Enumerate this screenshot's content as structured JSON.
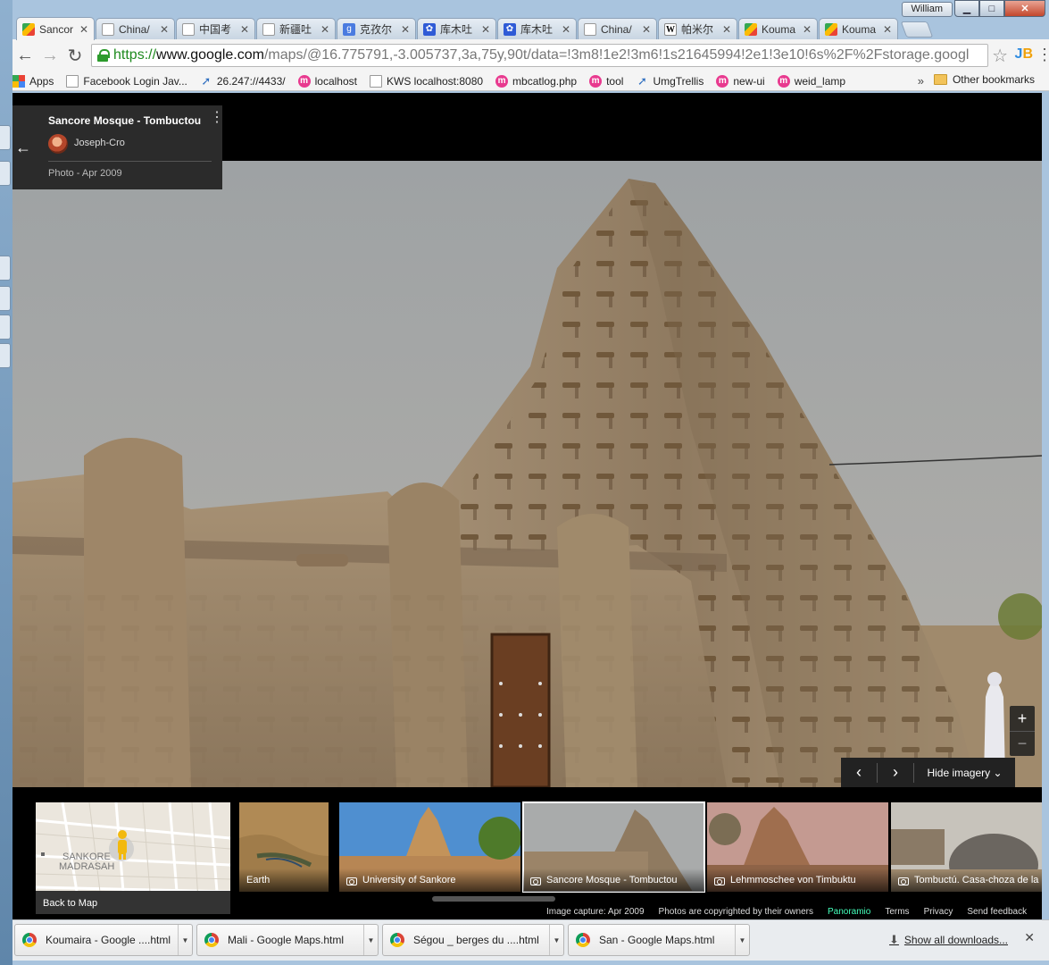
{
  "window": {
    "user_label": "William",
    "controls": {
      "minimize": "▁",
      "maximize": "□",
      "close": "✕"
    }
  },
  "tabs": [
    {
      "title": "Sancor",
      "icon": "maps-icon",
      "active": true
    },
    {
      "title": "China/",
      "icon": "page-icon"
    },
    {
      "title": "中国考",
      "icon": "page-icon"
    },
    {
      "title": "新疆吐",
      "icon": "page-icon"
    },
    {
      "title": "克孜尔",
      "icon": "google-g-icon"
    },
    {
      "title": "库木吐",
      "icon": "baidu-paw-icon"
    },
    {
      "title": "库木吐",
      "icon": "baidu-paw-icon"
    },
    {
      "title": "China/",
      "icon": "page-icon"
    },
    {
      "title": "帕米尔",
      "icon": "wikipedia-icon"
    },
    {
      "title": "Kouma",
      "icon": "maps-icon"
    },
    {
      "title": "Kouma",
      "icon": "maps-icon"
    }
  ],
  "toolbar": {
    "back": "←",
    "forward": "→",
    "reload": "↻",
    "url_scheme": "https://",
    "url_host": "www.google.com",
    "url_rest": "/maps/@16.775791,-3.005737,3a,75y,90t/data=!3m8!1e2!3m6!1s21645994!2e1!3e10!6s%2F%2Fstorage.googl",
    "star": "☆",
    "ext_j": "J",
    "ext_b": "B",
    "menu": "⋮"
  },
  "bookmarks": [
    {
      "label": "Apps",
      "icon": "apps-icon"
    },
    {
      "label": "Facebook Login Jav...",
      "icon": "page-icon"
    },
    {
      "label": "26.247://4433/",
      "icon": "arrow-icon"
    },
    {
      "label": "localhost",
      "icon": "pink-m-icon"
    },
    {
      "label": "KWS localhost:8080",
      "icon": "page-icon"
    },
    {
      "label": "mbcatlog.php",
      "icon": "pink-m-icon"
    },
    {
      "label": "tool",
      "icon": "pink-m-icon"
    },
    {
      "label": "UmgTrellis",
      "icon": "arrow-icon"
    },
    {
      "label": "new-ui",
      "icon": "pink-m-icon"
    },
    {
      "label": "weid_lamp",
      "icon": "pink-m-icon"
    }
  ],
  "bookmarks_more": "»",
  "bookmarks_other": "Other bookmarks",
  "card": {
    "back": "←",
    "title": "Sancore Mosque - Tombuctou",
    "author": "Joseph-Cro",
    "date": "Photo - Apr 2009",
    "menu": "⋮"
  },
  "controls": {
    "zoom_in": "+",
    "zoom_out": "−",
    "prev": "‹",
    "next": "›",
    "hide_imagery": "Hide imagery ⌄"
  },
  "map_tile": {
    "label_line1": "SANKORE",
    "label_line2": "MADRASAH",
    "back_to_map": "Back to Map"
  },
  "thumbnails": [
    {
      "caption": "Earth",
      "camera": false
    },
    {
      "caption": "University of Sankore",
      "camera": true
    },
    {
      "caption": "Sancore Mosque - Tombuctou",
      "camera": true,
      "selected": true
    },
    {
      "caption": "Lehmmoschee von Timbuktu",
      "camera": true
    },
    {
      "caption": "Tombuctú. Casa-choza de la",
      "camera": true
    }
  ],
  "footer": {
    "capture": "Image capture: Apr 2009",
    "copyright": "Photos are copyrighted by their owners",
    "panoramio": "Panoramio",
    "terms": "Terms",
    "privacy": "Privacy",
    "feedback": "Send feedback"
  },
  "downloads": [
    {
      "name": "Koumaira - Google ....html"
    },
    {
      "name": "Mali - Google Maps.html"
    },
    {
      "name": "Ségou _ berges du ....html"
    },
    {
      "name": "San - Google Maps.html"
    }
  ],
  "downloads_show_all": "Show all downloads...",
  "downloads_close": "✕",
  "colors": {
    "accent_url": "#1e8a1e",
    "panoramio": "#44ffbb",
    "sky": "#9ba0a3",
    "mud": "#9b8468"
  }
}
